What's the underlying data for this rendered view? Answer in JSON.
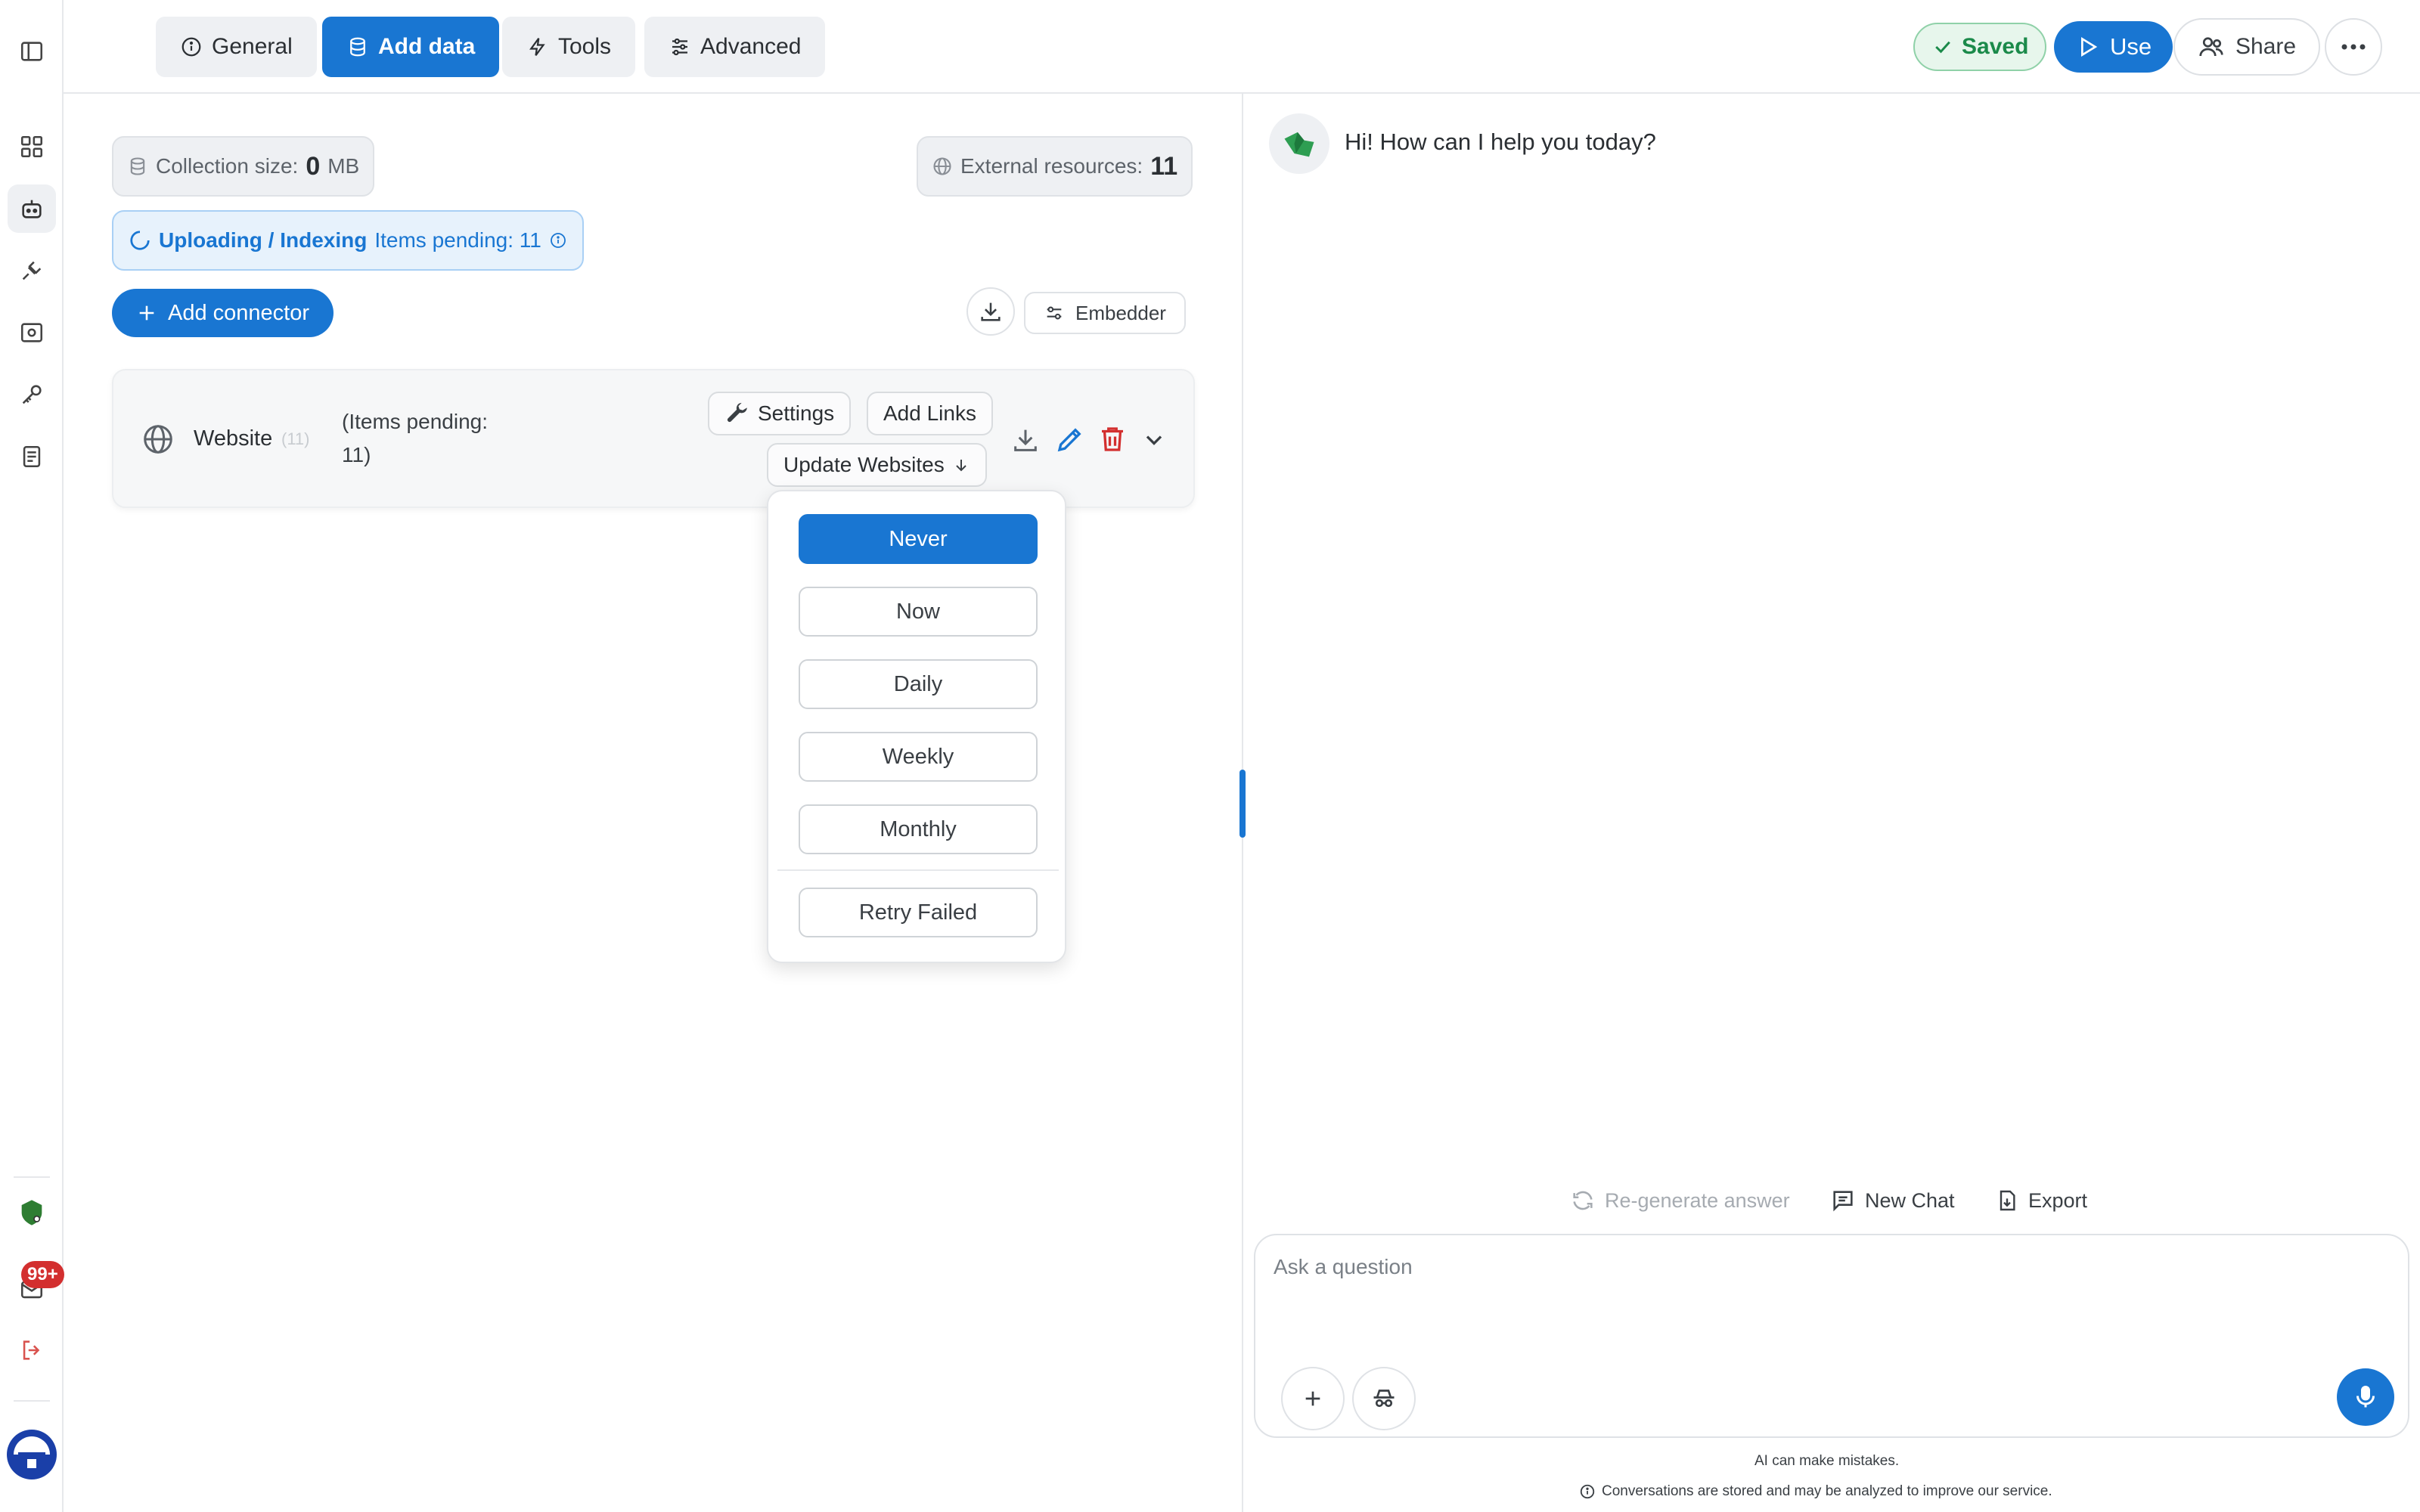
{
  "tabs": [
    {
      "label": "General",
      "icon": "info-icon"
    },
    {
      "label": "Add data",
      "icon": "database-icon",
      "active": true
    },
    {
      "label": "Tools",
      "icon": "bolt-icon"
    },
    {
      "label": "Advanced",
      "icon": "sliders-icon"
    }
  ],
  "header": {
    "saved_label": "Saved",
    "use_label": "Use",
    "share_label": "Share"
  },
  "notifications": {
    "badge": "99+"
  },
  "collection": {
    "label": "Collection size:",
    "value": "0",
    "unit": "MB"
  },
  "external": {
    "label": "External resources:",
    "value": "11"
  },
  "status": {
    "state": "Uploading / Indexing",
    "pending": "Items pending: 11"
  },
  "actions": {
    "add_connector": "Add connector",
    "embedder": "Embedder"
  },
  "connector": {
    "name": "Website",
    "count_hint": "(11)",
    "pending_line1": "(Items pending:",
    "pending_line2": "11)",
    "settings_label": "Settings",
    "add_links_label": "Add Links",
    "update_label": "Update Websites"
  },
  "update_menu": {
    "options": [
      "Never",
      "Now",
      "Daily",
      "Weekly",
      "Monthly"
    ],
    "selected": "Never",
    "retry_label": "Retry Failed"
  },
  "chat": {
    "greeting": "Hi! How can I help you today?",
    "regenerate": "Re-generate answer",
    "new_chat": "New Chat",
    "export": "Export",
    "placeholder": "Ask a question",
    "disclaimer": "AI can make mistakes.",
    "privacy": "Conversations are stored and may be analyzed to improve our service."
  },
  "colors": {
    "accent": "#1976d2",
    "saved_green": "#1b8a4a",
    "danger": "#d32f2f"
  }
}
